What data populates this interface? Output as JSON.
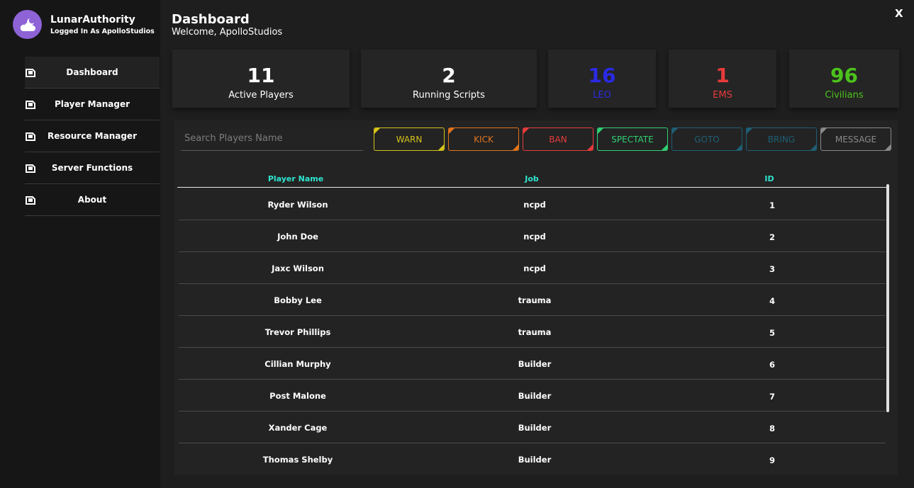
{
  "brand": {
    "title": "LunarAuthority",
    "subtitle": "Logged In As ApolloStudios",
    "logo_icon": "moon-cloud-icon"
  },
  "sidebar": {
    "items": [
      {
        "label": "Dashboard",
        "icon": "nav-square-icon",
        "active": true
      },
      {
        "label": "Player Manager",
        "icon": "nav-square-icon"
      },
      {
        "label": "Resource Manager",
        "icon": "nav-square-icon"
      },
      {
        "label": "Server Functions",
        "icon": "nav-square-icon"
      },
      {
        "label": "About",
        "icon": "nav-square-icon"
      }
    ]
  },
  "header": {
    "title": "Dashboard",
    "welcome": "Welcome, ApolloStudios",
    "close_label": "X"
  },
  "stats": [
    {
      "value": "11",
      "label": "Active Players",
      "color": "#ffffff"
    },
    {
      "value": "2",
      "label": "Running Scripts",
      "color": "#ffffff"
    },
    {
      "value": "16",
      "label": "LEO",
      "color": "#2a2ae6"
    },
    {
      "value": "1",
      "label": "EMS",
      "color": "#e83a3a"
    },
    {
      "value": "96",
      "label": "Civilians",
      "color": "#4cc21b"
    }
  ],
  "search": {
    "placeholder": "Search Players Name"
  },
  "actions": [
    {
      "label": "WARN",
      "color": "#d4c21a"
    },
    {
      "label": "KICK",
      "color": "#e0741c"
    },
    {
      "label": "BAN",
      "color": "#e53b3b"
    },
    {
      "label": "SPECTATE",
      "color": "#2fcf73"
    },
    {
      "label": "GOTO",
      "color": "#1e5f75"
    },
    {
      "label": "BRING",
      "color": "#1e5f75"
    },
    {
      "label": "MESSAGE",
      "color": "#8a8a8a"
    }
  ],
  "table": {
    "columns": [
      "Player Name",
      "Job",
      "ID"
    ],
    "rows": [
      [
        "Ryder Wilson",
        "ncpd",
        "1"
      ],
      [
        "John Doe",
        "ncpd",
        "2"
      ],
      [
        "Jaxc Wilson",
        "ncpd",
        "3"
      ],
      [
        "Bobby Lee",
        "trauma",
        "4"
      ],
      [
        "Trevor Phillips",
        "trauma",
        "5"
      ],
      [
        "Cillian Murphy",
        "Builder",
        "6"
      ],
      [
        "Post Malone",
        "Builder",
        "7"
      ],
      [
        "Xander Cage",
        "Builder",
        "8"
      ],
      [
        "Thomas Shelby",
        "Builder",
        "9"
      ]
    ]
  }
}
